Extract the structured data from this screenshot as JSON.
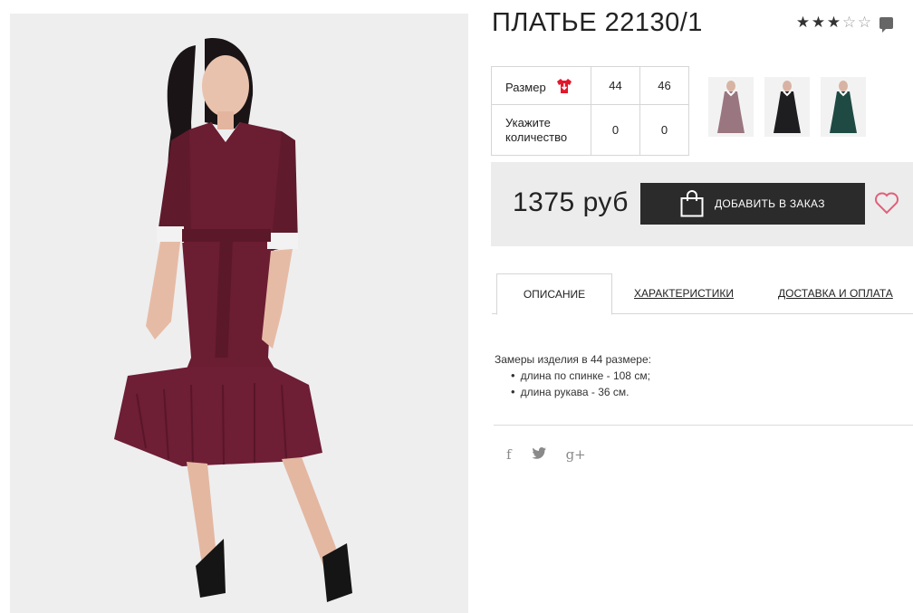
{
  "product": {
    "title": "ПЛАТЬЕ 22130/1",
    "rating": {
      "filled": 3,
      "total": 5
    }
  },
  "size_table": {
    "size_label": "Размер",
    "sizes": [
      "44",
      "46"
    ],
    "quantity_label": "Укажите количество",
    "quantities": [
      "0",
      "0"
    ]
  },
  "thumbnails": [
    {
      "color": "#9a7680",
      "name": "mauve"
    },
    {
      "color": "#1e1e20",
      "name": "black"
    },
    {
      "color": "#1f4a44",
      "name": "green"
    }
  ],
  "purchase": {
    "price": "1375 руб",
    "order_button": "ДОБАВИТЬ В ЗАКАЗ"
  },
  "tabs": [
    {
      "label": "ОПИСАНИЕ",
      "active": true
    },
    {
      "label": "ХАРАКТЕРИСТИКИ",
      "active": false
    },
    {
      "label": "ДОСТАВКА И ОПЛАТА",
      "active": false
    }
  ],
  "description": {
    "intro": "Замеры изделия в 44 размере:",
    "items": [
      "длина по спинке - 108 см;",
      "длина рукава - 36 см."
    ]
  },
  "social": [
    {
      "icon": "facebook-icon",
      "glyph": "f"
    },
    {
      "icon": "twitter-icon",
      "glyph": "y"
    },
    {
      "icon": "google-plus-icon",
      "glyph": "g+"
    }
  ],
  "colors": {
    "dress": "#6b1d32",
    "button": "#2b2b2b",
    "heart": "#e0607a",
    "shirt_icon": "#e3172b"
  }
}
